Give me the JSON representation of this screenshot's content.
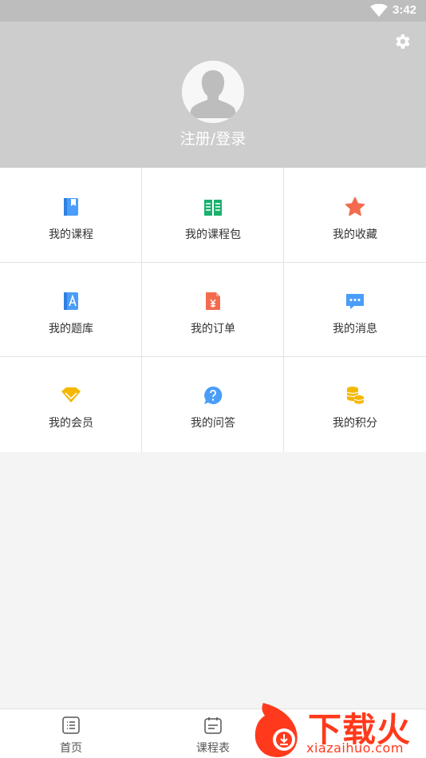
{
  "status_bar": {
    "time": "3:42"
  },
  "header": {
    "login_label": "注册/登录"
  },
  "menu": [
    {
      "label": "我的课程",
      "icon": "course-icon",
      "color": "#4a9df8"
    },
    {
      "label": "我的课程包",
      "icon": "course-package-icon",
      "color": "#1bb06e"
    },
    {
      "label": "我的收藏",
      "icon": "star-icon",
      "color": "#f36b4f"
    },
    {
      "label": "我的题库",
      "icon": "question-bank-icon",
      "color": "#4a9df8"
    },
    {
      "label": "我的订单",
      "icon": "order-icon",
      "color": "#f36b4f"
    },
    {
      "label": "我的消息",
      "icon": "message-icon",
      "color": "#4a9df8"
    },
    {
      "label": "我的会员",
      "icon": "membership-icon",
      "color": "#f5b700"
    },
    {
      "label": "我的问答",
      "icon": "qa-icon",
      "color": "#4a9df8"
    },
    {
      "label": "我的积分",
      "icon": "points-icon",
      "color": "#f5b700"
    }
  ],
  "tabbar": [
    {
      "label": "首页",
      "icon": "home-list-icon"
    },
    {
      "label": "课程表",
      "icon": "schedule-icon"
    }
  ],
  "watermark": {
    "brand": "下载火",
    "domain": "xiazaihuo.com"
  }
}
